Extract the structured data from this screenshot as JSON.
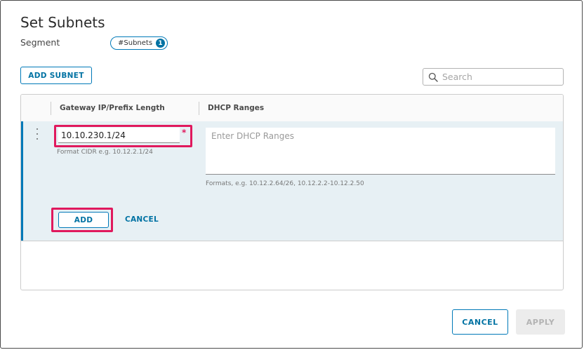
{
  "dialog": {
    "title": "Set Subnets",
    "segment_label": "Segment",
    "subnets_pill": {
      "label": "#Subnets",
      "count": "1"
    }
  },
  "toolbar": {
    "add_subnet_label": "ADD SUBNET",
    "search_placeholder": "Search"
  },
  "grid": {
    "columns": [
      "Gateway IP/Prefix Length",
      "DHCP Ranges"
    ],
    "edit_row": {
      "gateway_value": "10.10.230.1/24",
      "required_marker": "*",
      "gateway_hint": "Format CIDR e.g. 10.12.2.1/24",
      "dhcp_placeholder": "Enter DHCP Ranges",
      "dhcp_hint": "Formats, e.g. 10.12.2.64/26, 10.12.2.2-10.12.2.50",
      "add_label": "ADD",
      "cancel_label": "CANCEL"
    }
  },
  "footer": {
    "cancel_label": "CANCEL",
    "apply_label": "APPLY"
  },
  "colors": {
    "accent": "#0079b8",
    "highlight": "#e0195d",
    "row_background": "#e7f0f4"
  }
}
